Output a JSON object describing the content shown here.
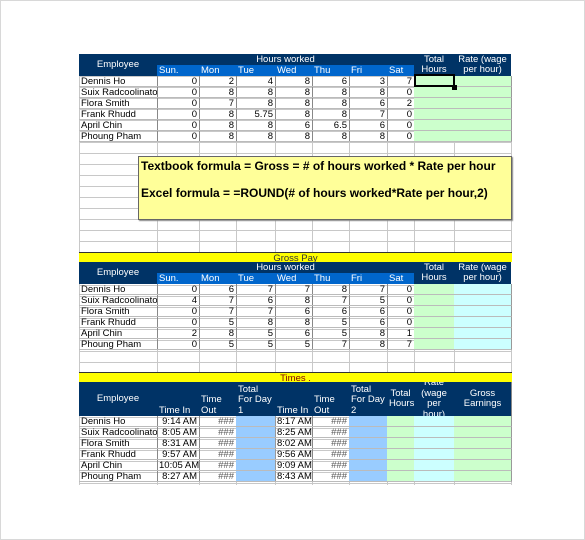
{
  "colors": {
    "header": "#003366",
    "day_header": "#0066cc",
    "total_hours": "#ccffcc",
    "rate": "#ccffff",
    "day_total": "#99ccff",
    "band": "#ffff00",
    "note": "#ffff99"
  },
  "hours_table": {
    "employee_label": "Employee",
    "hours_worked_label": "Hours worked",
    "days": [
      "Sun.",
      "Mon",
      "Tue",
      "Wed",
      "Thu",
      "Fri",
      "Sat"
    ],
    "total_hours_label": "Total Hours",
    "rate_label": "Rate (wage per hour)",
    "rows": [
      {
        "name": "Dennis Ho",
        "hours": [
          "0",
          "2",
          "4",
          "8",
          "6",
          "3",
          "7"
        ]
      },
      {
        "name": "Suix Radcoolinato",
        "hours": [
          "0",
          "8",
          "8",
          "8",
          "8",
          "8",
          "0"
        ]
      },
      {
        "name": "Flora Smith",
        "hours": [
          "0",
          "7",
          "8",
          "8",
          "8",
          "6",
          "2"
        ]
      },
      {
        "name": "Frank Rhudd",
        "hours": [
          "0",
          "8",
          "5.75",
          "8",
          "8",
          "7",
          "0"
        ]
      },
      {
        "name": "April Chin",
        "hours": [
          "0",
          "8",
          "8",
          "6",
          "6.5",
          "6",
          "0"
        ]
      },
      {
        "name": "Phoung Pham",
        "hours": [
          "0",
          "8",
          "8",
          "8",
          "8",
          "8",
          "0"
        ]
      }
    ]
  },
  "note": {
    "line1": "Textbook formula = Gross = # of hours worked * Rate per hour",
    "line2": "Excel formula = =ROUND(# of hours worked*Rate per hour,2)"
  },
  "gross_pay_table": {
    "band_label": "Gross Pay",
    "employee_label": "Employee",
    "hours_worked_label": "Hours worked",
    "days": [
      "Sun.",
      "Mon",
      "Tue",
      "Wed",
      "Thu",
      "Fri",
      "Sat"
    ],
    "total_hours_label": "Total Hours",
    "rate_label": "Rate (wage per hour)",
    "rows": [
      {
        "name": "Dennis Ho",
        "hours": [
          "0",
          "6",
          "7",
          "7",
          "8",
          "7",
          "0"
        ]
      },
      {
        "name": "Suix Radcoolinato",
        "hours": [
          "4",
          "7",
          "6",
          "8",
          "7",
          "5",
          "0"
        ]
      },
      {
        "name": "Flora Smith",
        "hours": [
          "0",
          "7",
          "7",
          "6",
          "6",
          "6",
          "0"
        ]
      },
      {
        "name": "Frank Rhudd",
        "hours": [
          "0",
          "5",
          "8",
          "8",
          "5",
          "6",
          "0"
        ]
      },
      {
        "name": "April Chin",
        "hours": [
          "2",
          "8",
          "5",
          "6",
          "5",
          "8",
          "1"
        ]
      },
      {
        "name": "Phoung Pham",
        "hours": [
          "0",
          "5",
          "5",
          "5",
          "7",
          "8",
          "7"
        ]
      }
    ]
  },
  "times_table": {
    "band_label": "Times .",
    "headers": [
      "Employee",
      "Time In",
      "Time Out",
      "Total For Day 1",
      "Time In",
      "Time Out",
      "Total For Day 2",
      "Total Hours",
      "Rate (wage per hour)",
      "Gross Earnings"
    ],
    "rows": [
      {
        "name": "Dennis Ho",
        "time_in_1": "9:14 AM",
        "time_out_1": "###",
        "time_in_2": "8:17 AM",
        "time_out_2": "###"
      },
      {
        "name": "Suix Radcoolinato",
        "time_in_1": "8:05 AM",
        "time_out_1": "###",
        "time_in_2": "8:25 AM",
        "time_out_2": "###"
      },
      {
        "name": "Flora Smith",
        "time_in_1": "8:31 AM",
        "time_out_1": "###",
        "time_in_2": "8:02 AM",
        "time_out_2": "###"
      },
      {
        "name": "Frank Rhudd",
        "time_in_1": "9:57 AM",
        "time_out_1": "###",
        "time_in_2": "9:56 AM",
        "time_out_2": "###"
      },
      {
        "name": "April Chin",
        "time_in_1": "10:05 AM",
        "time_out_1": "###",
        "time_in_2": "9:09 AM",
        "time_out_2": "###"
      },
      {
        "name": "Phoung Pham",
        "time_in_1": "8:27 AM",
        "time_out_1": "###",
        "time_in_2": "8:43 AM",
        "time_out_2": "###"
      }
    ]
  }
}
